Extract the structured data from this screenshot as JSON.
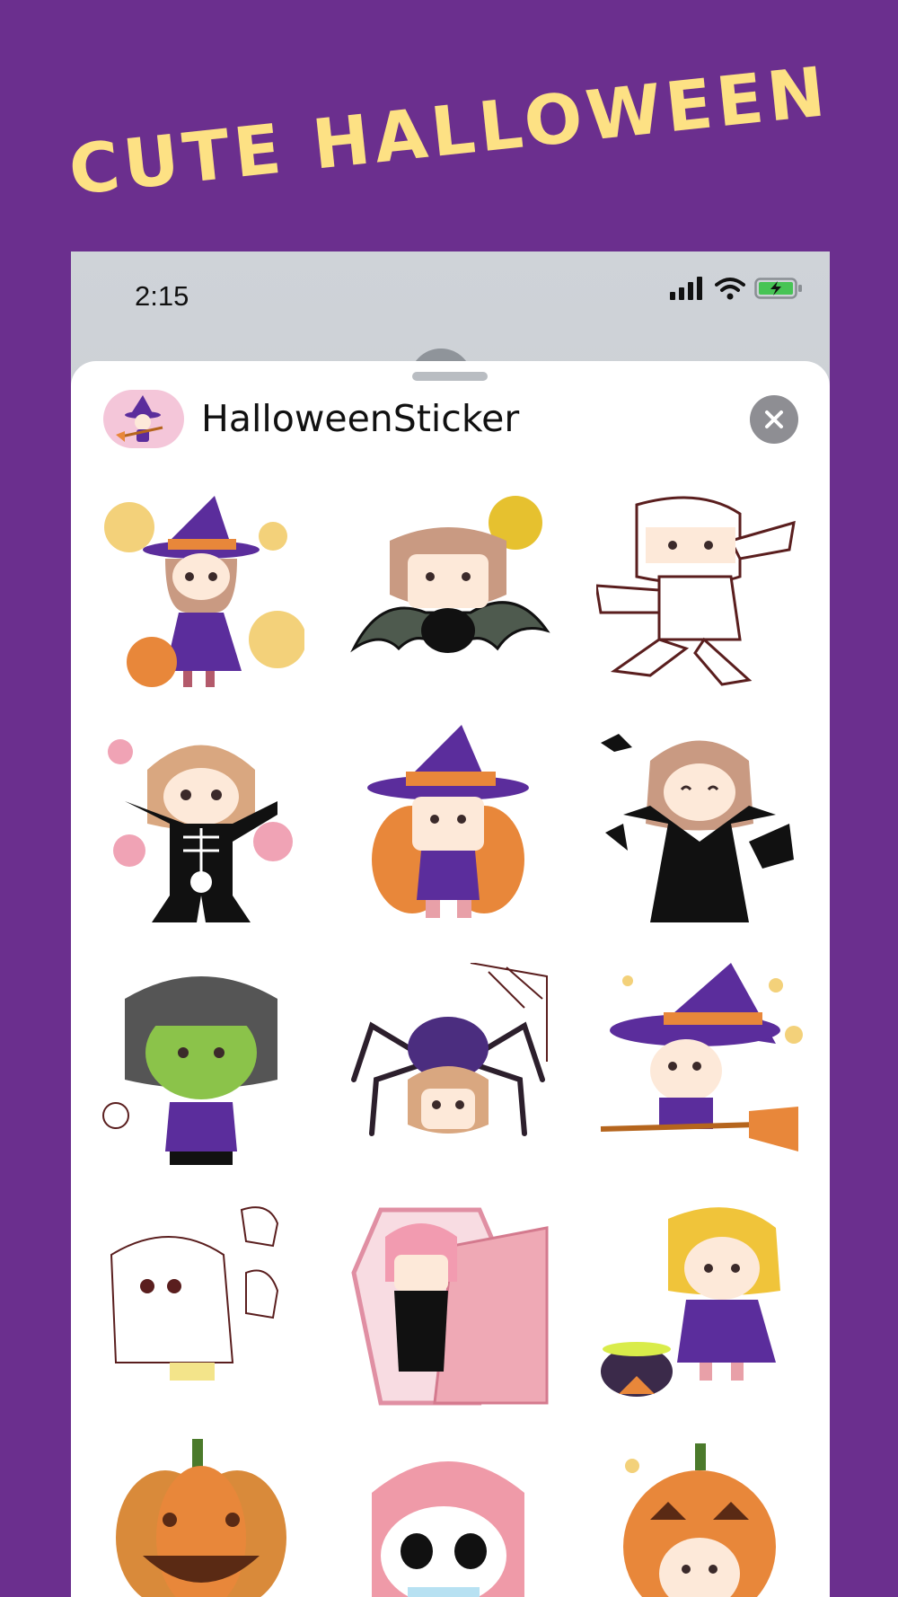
{
  "headline": "CUTE HALLOWEEN",
  "status": {
    "time": "2:15"
  },
  "sheet": {
    "app_name": "HalloweenSticker"
  },
  "stickers": [
    {
      "name": "witch-candy"
    },
    {
      "name": "bat"
    },
    {
      "name": "mummy"
    },
    {
      "name": "skeleton"
    },
    {
      "name": "pumpkin-witch"
    },
    {
      "name": "vampire"
    },
    {
      "name": "frankenstein"
    },
    {
      "name": "spider"
    },
    {
      "name": "witch-broom"
    },
    {
      "name": "ghost"
    },
    {
      "name": "coffin"
    },
    {
      "name": "cauldron"
    },
    {
      "name": "jack-o-lantern"
    },
    {
      "name": "skull-face"
    },
    {
      "name": "pumpkin-costume"
    }
  ],
  "colors": {
    "background": "#6b2f8e",
    "headline": "#fde184",
    "accent_purple": "#5b2d9c",
    "pumpkin": "#e8873a"
  },
  "icons": [
    "signal-icon",
    "wifi-icon",
    "battery-charging-icon",
    "close-icon"
  ]
}
